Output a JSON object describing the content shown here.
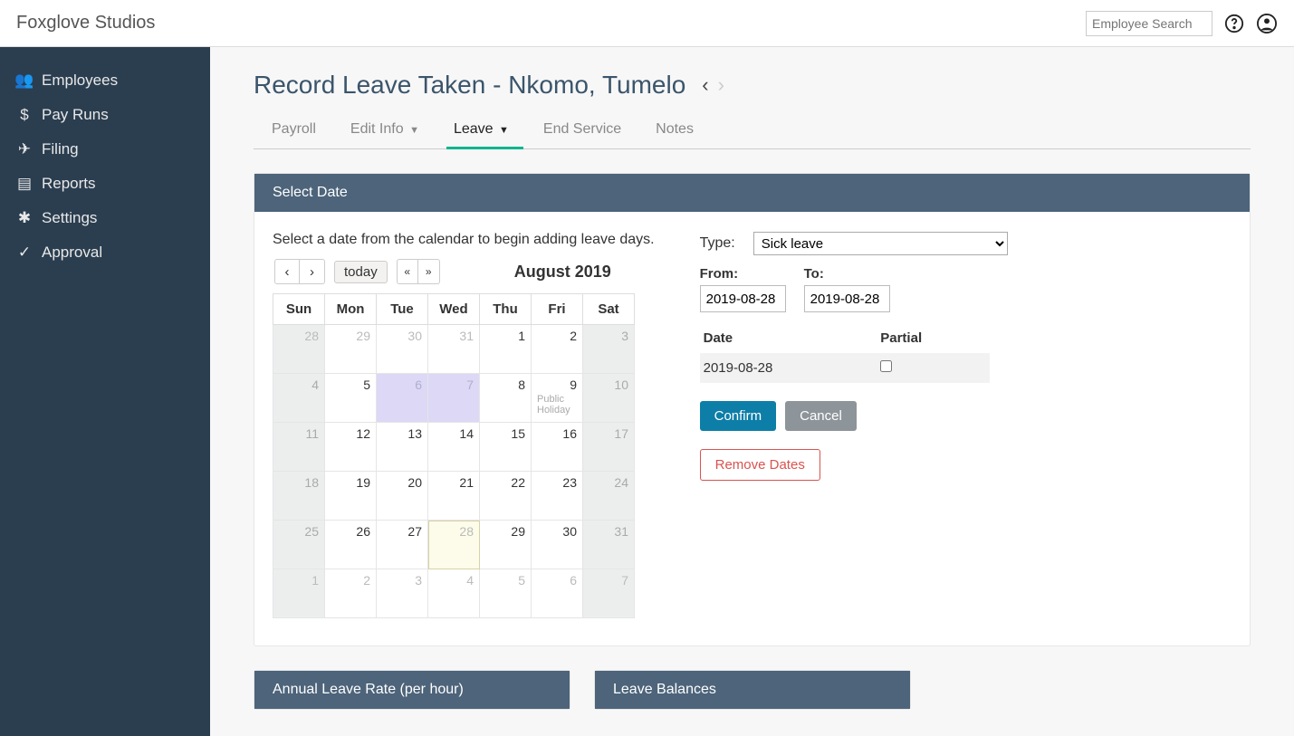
{
  "brand": "Foxglove Studios",
  "search_placeholder": "Employee Search",
  "sidebar": {
    "items": [
      {
        "label": "Employees",
        "icon": "employees-icon"
      },
      {
        "label": "Pay Runs",
        "icon": "dollar-icon"
      },
      {
        "label": "Filing",
        "icon": "paper-plane-icon"
      },
      {
        "label": "Reports",
        "icon": "report-icon"
      },
      {
        "label": "Settings",
        "icon": "gear-icon"
      },
      {
        "label": "Approval",
        "icon": "check-icon"
      }
    ]
  },
  "page": {
    "title": "Record Leave Taken - Nkomo, Tumelo",
    "tabs": [
      "Payroll",
      "Edit Info",
      "Leave",
      "End Service",
      "Notes"
    ],
    "active_tab": 2
  },
  "panel": {
    "select_date_header": "Select Date",
    "instruction": "Select a date from the calendar to begin adding leave days.",
    "annual_rate_header": "Annual Leave Rate (per hour)",
    "leave_balances_header": "Leave Balances"
  },
  "calendar": {
    "today_label": "today",
    "title": "August 2019",
    "dow": [
      "Sun",
      "Mon",
      "Tue",
      "Wed",
      "Thu",
      "Fri",
      "Sat"
    ],
    "weeks": [
      [
        {
          "n": "28",
          "other": true,
          "weekend": true
        },
        {
          "n": "29",
          "other": true
        },
        {
          "n": "30",
          "other": true
        },
        {
          "n": "31",
          "other": true
        },
        {
          "n": "1"
        },
        {
          "n": "2"
        },
        {
          "n": "3",
          "weekend": true
        }
      ],
      [
        {
          "n": "4",
          "weekend": true
        },
        {
          "n": "5"
        },
        {
          "n": "6",
          "hl": true
        },
        {
          "n": "7",
          "hl": true
        },
        {
          "n": "8"
        },
        {
          "n": "9",
          "sub": "Public Holiday"
        },
        {
          "n": "10",
          "weekend": true
        }
      ],
      [
        {
          "n": "11",
          "weekend": true
        },
        {
          "n": "12"
        },
        {
          "n": "13"
        },
        {
          "n": "14"
        },
        {
          "n": "15"
        },
        {
          "n": "16"
        },
        {
          "n": "17",
          "weekend": true
        }
      ],
      [
        {
          "n": "18",
          "weekend": true
        },
        {
          "n": "19"
        },
        {
          "n": "20"
        },
        {
          "n": "21"
        },
        {
          "n": "22"
        },
        {
          "n": "23"
        },
        {
          "n": "24",
          "weekend": true
        }
      ],
      [
        {
          "n": "25",
          "weekend": true
        },
        {
          "n": "26"
        },
        {
          "n": "27"
        },
        {
          "n": "28",
          "selected": true
        },
        {
          "n": "29"
        },
        {
          "n": "30"
        },
        {
          "n": "31",
          "weekend": true
        }
      ],
      [
        {
          "n": "1",
          "other": true,
          "weekend": true
        },
        {
          "n": "2",
          "other": true
        },
        {
          "n": "3",
          "other": true
        },
        {
          "n": "4",
          "other": true
        },
        {
          "n": "5",
          "other": true
        },
        {
          "n": "6",
          "other": true
        },
        {
          "n": "7",
          "other": true,
          "weekend": true
        }
      ]
    ]
  },
  "form": {
    "type_label": "Type:",
    "type_value": "Sick leave",
    "from_label": "From:",
    "to_label": "To:",
    "from_value": "2019-08-28",
    "to_value": "2019-08-28",
    "date_col": "Date",
    "partial_col": "Partial",
    "rows": [
      {
        "date": "2019-08-28",
        "partial": false
      }
    ],
    "confirm_label": "Confirm",
    "cancel_label": "Cancel",
    "remove_label": "Remove Dates"
  }
}
